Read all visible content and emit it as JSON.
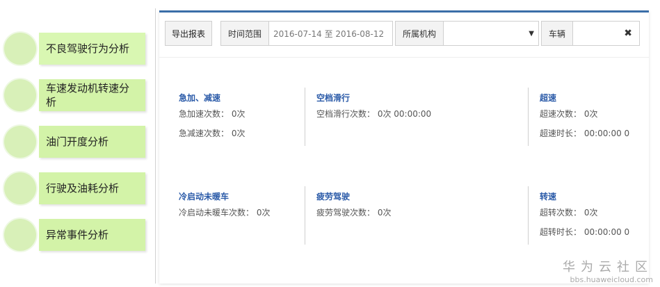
{
  "menu": {
    "items": [
      {
        "label": "不良驾驶行为分析"
      },
      {
        "label": "车速发动机转速分析"
      },
      {
        "label": "油门开度分析"
      },
      {
        "label": "行驶及油耗分析"
      },
      {
        "label": "异常事件分析"
      }
    ]
  },
  "toolbar": {
    "export_label": "导出报表",
    "time_label": "时间范围",
    "time_value": "2016-07-14 至 2016-08-12",
    "org_label": "所属机构",
    "org_value": "",
    "vehicle_label": "车辆",
    "vehicle_value": ""
  },
  "groups": [
    {
      "title": "急加、减速",
      "rows": [
        "急加速次数：  0次",
        "急减速次数：  0次"
      ]
    },
    {
      "title": "空档滑行",
      "rows": [
        "空档滑行次数： 0次      00:00:00"
      ]
    },
    {
      "title": "超速",
      "rows": [
        "超速次数： 0次",
        "超速时长： 00:00:00   0"
      ]
    },
    {
      "title": "冷启动未暖车",
      "rows": [
        "冷启动未暖车次数： 0次"
      ]
    },
    {
      "title": "疲劳驾驶",
      "rows": [
        "疲劳驾驶次数： 0次"
      ]
    },
    {
      "title": "转速",
      "rows": [
        "超转次数： 0次",
        "超转时长： 00:00:00   0"
      ]
    }
  ],
  "watermark": {
    "cn": "华为云社区",
    "en": "bbs.huaweicloud.com"
  },
  "colors": {
    "menu_green": "#d3f3a8",
    "accent_blue": "#2a5aa8",
    "panel_border": "#3a6ea8"
  }
}
